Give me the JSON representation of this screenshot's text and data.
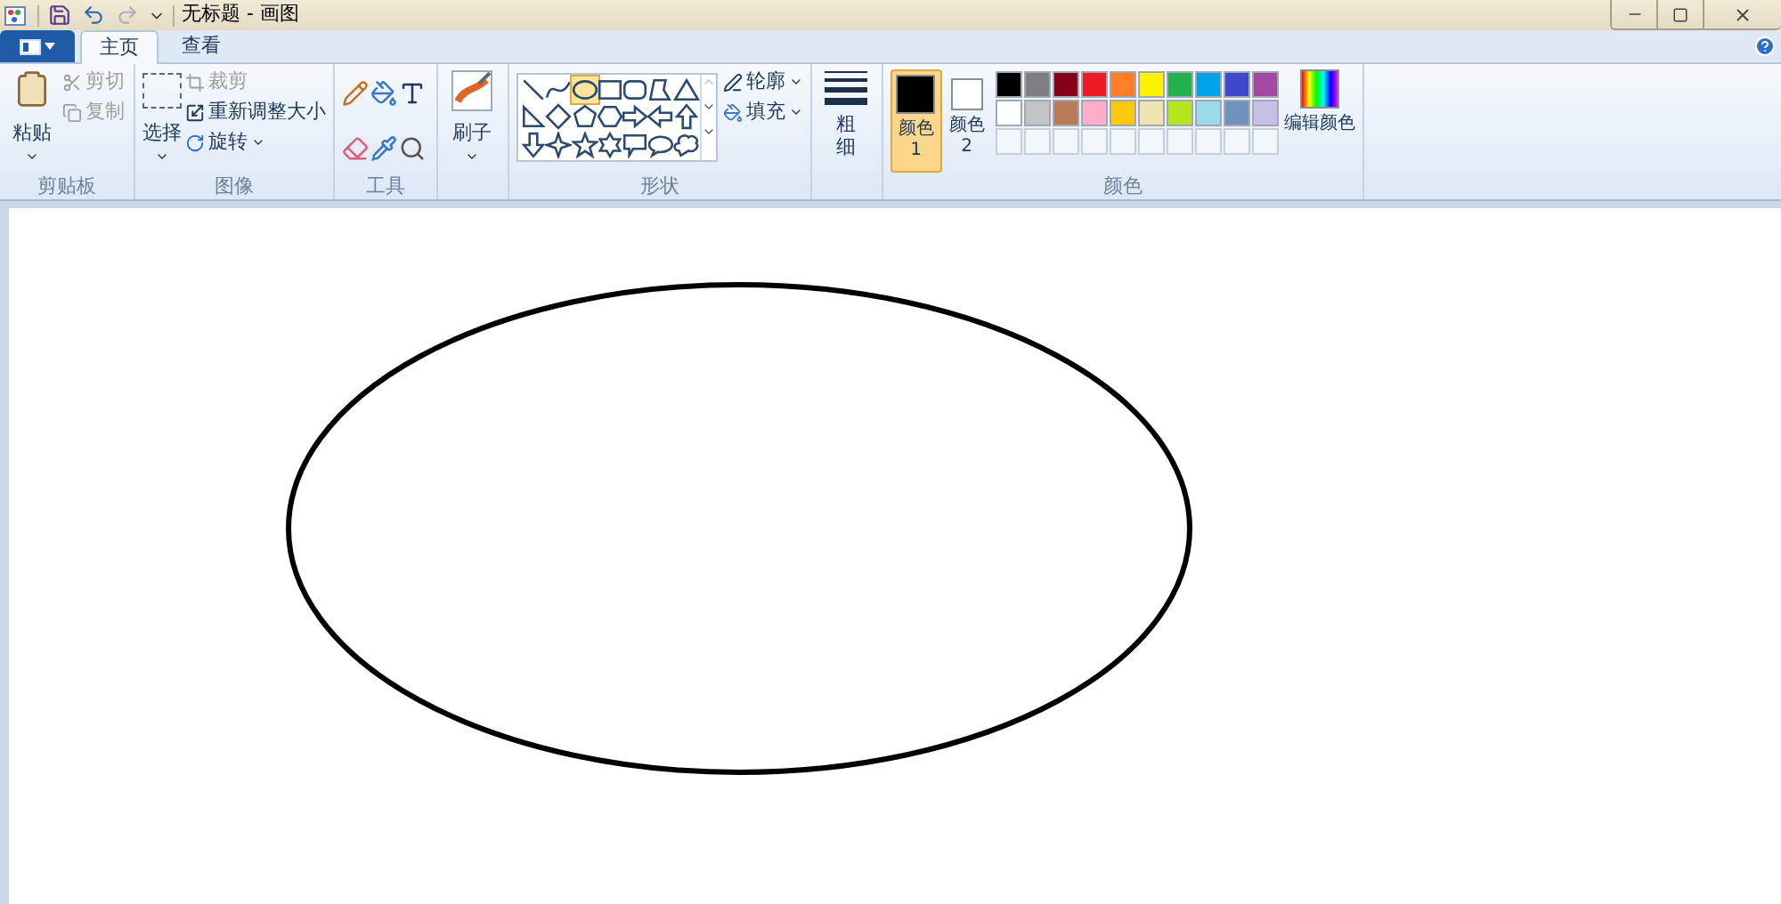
{
  "window": {
    "title": "无标题 - 画图"
  },
  "tabs": [
    {
      "label": "主页",
      "selected": true
    },
    {
      "label": "查看",
      "selected": false
    }
  ],
  "clipboard": {
    "label": "剪贴板",
    "paste": "粘贴",
    "cut": {
      "label": "剪切",
      "disabled": true
    },
    "copy": {
      "label": "复制",
      "disabled": true
    }
  },
  "image": {
    "label": "图像",
    "select": "选择",
    "crop": {
      "label": "裁剪",
      "disabled": true
    },
    "resize": "重新调整大小",
    "rotate": "旋转"
  },
  "tools": {
    "label": "工具"
  },
  "brushes": {
    "label": "刷子"
  },
  "shapes": {
    "label": "形状",
    "outline": "轮廓",
    "fill": "填充",
    "items": [
      {
        "kind": "line",
        "selected": false
      },
      {
        "kind": "curve",
        "selected": false
      },
      {
        "kind": "oval",
        "selected": true
      },
      {
        "kind": "rect",
        "selected": false
      },
      {
        "kind": "roundrect",
        "selected": false
      },
      {
        "kind": "polygon",
        "selected": false
      },
      {
        "kind": "triangle",
        "selected": false
      },
      {
        "kind": "righttriangle",
        "selected": false
      },
      {
        "kind": "diamond",
        "selected": false
      },
      {
        "kind": "pentagon",
        "selected": false
      },
      {
        "kind": "hexagon",
        "selected": false
      },
      {
        "kind": "arrowright",
        "selected": false
      },
      {
        "kind": "arrowleft",
        "selected": false
      },
      {
        "kind": "arrowup",
        "selected": false
      },
      {
        "kind": "arrowdown",
        "selected": false
      },
      {
        "kind": "star4",
        "selected": false
      },
      {
        "kind": "star5",
        "selected": false
      },
      {
        "kind": "star6",
        "selected": false
      },
      {
        "kind": "calloutrect",
        "selected": false
      },
      {
        "kind": "calloutoval",
        "selected": false
      },
      {
        "kind": "calloutcloud",
        "selected": false
      }
    ]
  },
  "size": {
    "label": "粗细"
  },
  "colors": {
    "label": "颜色",
    "color1": {
      "label": "颜色 1",
      "color": "#000000",
      "selected": true
    },
    "color2": {
      "label": "颜色 2",
      "color": "#ffffff",
      "selected": false
    },
    "edit": "编辑颜色",
    "palette": [
      [
        {
          "color": "#000000"
        },
        {
          "color": "#7f7f7f"
        },
        {
          "color": "#880015"
        },
        {
          "color": "#ed1c24"
        },
        {
          "color": "#ff7f27"
        },
        {
          "color": "#fff200"
        },
        {
          "color": "#22b14c"
        },
        {
          "color": "#00a2e8"
        },
        {
          "color": "#3f48cc"
        },
        {
          "color": "#a349a4"
        }
      ],
      [
        {
          "color": "#ffffff"
        },
        {
          "color": "#c3c3c3"
        },
        {
          "color": "#b97a57"
        },
        {
          "color": "#ffaec9"
        },
        {
          "color": "#ffc90e"
        },
        {
          "color": "#efe4b0"
        },
        {
          "color": "#b5e61d"
        },
        {
          "color": "#99d9ea"
        },
        {
          "color": "#7092be"
        },
        {
          "color": "#c8bfe7"
        }
      ],
      [
        {
          "kind": "empty"
        },
        {
          "kind": "empty"
        },
        {
          "kind": "empty"
        },
        {
          "kind": "empty"
        },
        {
          "kind": "empty"
        },
        {
          "kind": "empty"
        },
        {
          "kind": "empty"
        },
        {
          "kind": "empty"
        },
        {
          "kind": "empty"
        },
        {
          "kind": "empty"
        }
      ]
    ]
  }
}
